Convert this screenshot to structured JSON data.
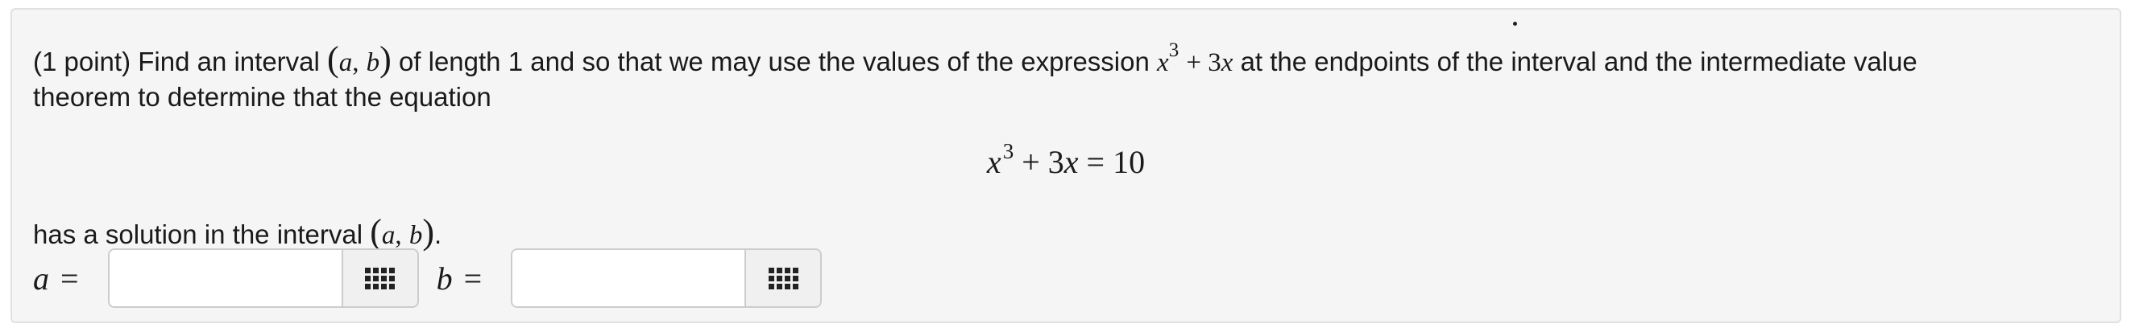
{
  "problem": {
    "points_label": "(1 point)",
    "intro_text": "Find an interval",
    "interval_open": "(",
    "var_a": "a",
    "comma": ",",
    "var_b": "b",
    "interval_close": ")",
    "text_after_interval": "of length 1 and so that we may use the values of the expression",
    "expr_var": "x",
    "expr_exp": "3",
    "expr_rest": "+ 3",
    "expr_var2": "x",
    "text_after_expr": "at the endpoints of the interval and the intermediate value",
    "line2_text": "theorem to determine that the equation",
    "equation": {
      "var": "x",
      "exp": "3",
      "rest": " + 3",
      "var2": "x",
      "rhs": " = 10"
    },
    "conclusion_text": "has a solution in the interval",
    "conclusion_end": "."
  },
  "answers": {
    "a_label": "a",
    "b_label": "b",
    "equals": "=",
    "a_value": "",
    "b_value": ""
  },
  "icons": {
    "palette": "equation-palette-grid-icon"
  }
}
